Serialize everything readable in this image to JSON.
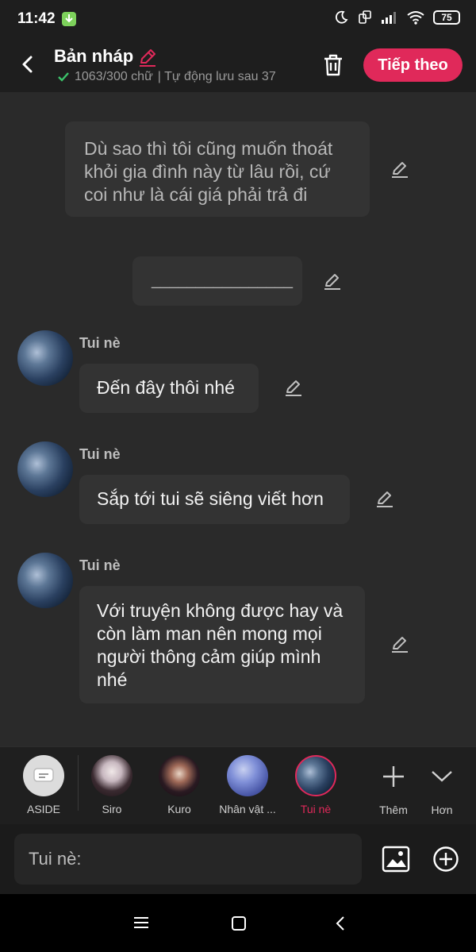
{
  "status_bar": {
    "time": "11:42",
    "battery": "75"
  },
  "header": {
    "title": "Bản nháp",
    "word_count": "1063/300 chữ",
    "autosave": "| Tự động lưu sau 37",
    "next_label": "Tiếp theo"
  },
  "messages": [
    {
      "type": "narration",
      "text": "Dù sao thì tôi cũng muốn thoát khỏi gia đình này từ lâu rồi, cứ coi như là cái giá phải trả đi"
    },
    {
      "type": "narration",
      "text": "________________"
    },
    {
      "type": "character",
      "name": "Tui nè",
      "text": "Đến đây thôi nhé"
    },
    {
      "type": "character",
      "name": "Tui nè",
      "text": "Sắp tới tui sẽ siêng viết hơn"
    },
    {
      "type": "character",
      "name": "Tui nè",
      "text": "Với truyện không được hay và còn làm man nên mong mọi người thông cảm giúp mình nhé"
    }
  ],
  "characters": [
    {
      "label": "ASIDE",
      "icon": "aside-icon"
    },
    {
      "label": "Siro"
    },
    {
      "label": "Kuro"
    },
    {
      "label": "Nhân vật ..."
    },
    {
      "label": "Tui nè",
      "selected": true
    }
  ],
  "char_actions": {
    "add_label": "Thêm",
    "more_label": "Hơn"
  },
  "input": {
    "placeholder": "Tui nè:"
  },
  "colors": {
    "accent": "#e0295a",
    "background": "#2a2a2a",
    "bubble": "#333333"
  }
}
